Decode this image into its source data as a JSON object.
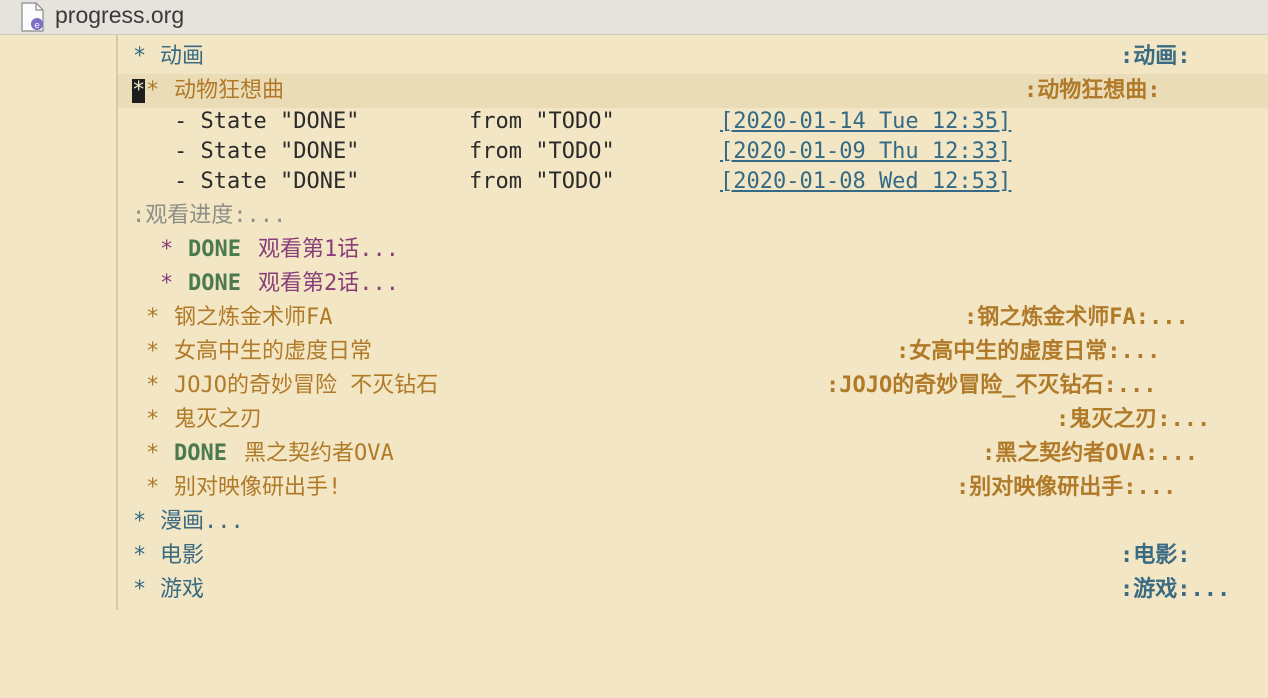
{
  "window": {
    "title": "progress.org"
  },
  "lines": {
    "l1": {
      "star": "*",
      "text": "动画",
      "tag": ":动画:"
    },
    "l2": {
      "cursor": "*",
      "star": "*",
      "text": "动物狂想曲",
      "tag": ":动物狂想曲:"
    },
    "log": [
      {
        "dash": "- State \"DONE\"",
        "from": "from \"TODO\"",
        "ts": "[2020-01-14 Tue 12:35]"
      },
      {
        "dash": "- State \"DONE\"",
        "from": "from \"TODO\"",
        "ts": "[2020-01-09 Thu 12:33]"
      },
      {
        "dash": "- State \"DONE\"",
        "from": "from \"TODO\"",
        "ts": "[2020-01-08 Wed 12:53]"
      }
    ],
    "drawer": ":观看进度:...",
    "sub1": {
      "star": "*",
      "kw": "DONE",
      "text": "观看第1话..."
    },
    "sub2": {
      "star": "*",
      "kw": "DONE",
      "text": "观看第2话..."
    },
    "h3": [
      {
        "star": "*",
        "kw": "",
        "text": "钢之炼金术师FA",
        "tag": ":钢之炼金术师FA:..."
      },
      {
        "star": "*",
        "kw": "",
        "text": "女高中生的虚度日常",
        "tag": ":女高中生的虚度日常:..."
      },
      {
        "star": "*",
        "kw": "",
        "text": "JOJO的奇妙冒险 不灭钻石",
        "tag": ":JOJO的奇妙冒险_不灭钻石:..."
      },
      {
        "star": "*",
        "kw": "",
        "text": "鬼灭之刃",
        "tag": ":鬼灭之刃:..."
      },
      {
        "star": "*",
        "kw": "DONE",
        "text": "黑之契约者OVA",
        "tag": ":黑之契约者OVA:..."
      },
      {
        "star": "*",
        "kw": "",
        "text": "别对映像研出手!",
        "tag": ":别对映像研出手:..."
      }
    ],
    "l_manga": {
      "star": "*",
      "text": "漫画..."
    },
    "l_movie": {
      "star": "*",
      "text": "电影",
      "tag": ":电影:"
    },
    "l_game": {
      "star": "*",
      "text": "游戏",
      "tag": ":游戏:..."
    }
  },
  "icons": {
    "file": "org-file-icon"
  },
  "colors": {
    "heading1": "#3a6b83",
    "heading2": "#b07a28",
    "heading3": "#8a3e79",
    "done": "#4b7a4f"
  }
}
